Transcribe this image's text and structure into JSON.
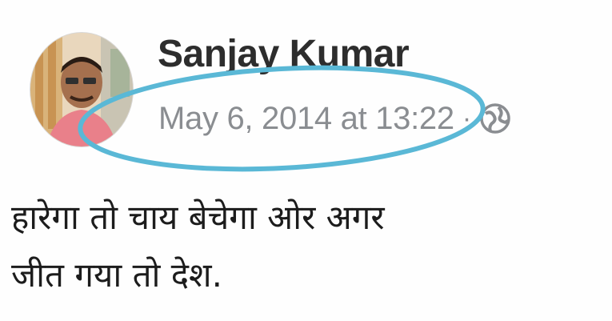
{
  "post": {
    "author": "Sanjay Kumar",
    "timestamp": "May 6, 2014 at 13:22",
    "separator": "·",
    "audience_icon": "globe-icon",
    "text_lines": [
      "हारेगा तो चाय बेचेगा ओर अगर",
      "जीत गया तो देश."
    ]
  },
  "colors": {
    "highlight": "#5ab8d6",
    "meta_text": "#8a8d91",
    "name_text": "#2d2d2d"
  },
  "icons": {
    "avatar": "profile-photo",
    "annotation": "highlight-ellipse"
  }
}
